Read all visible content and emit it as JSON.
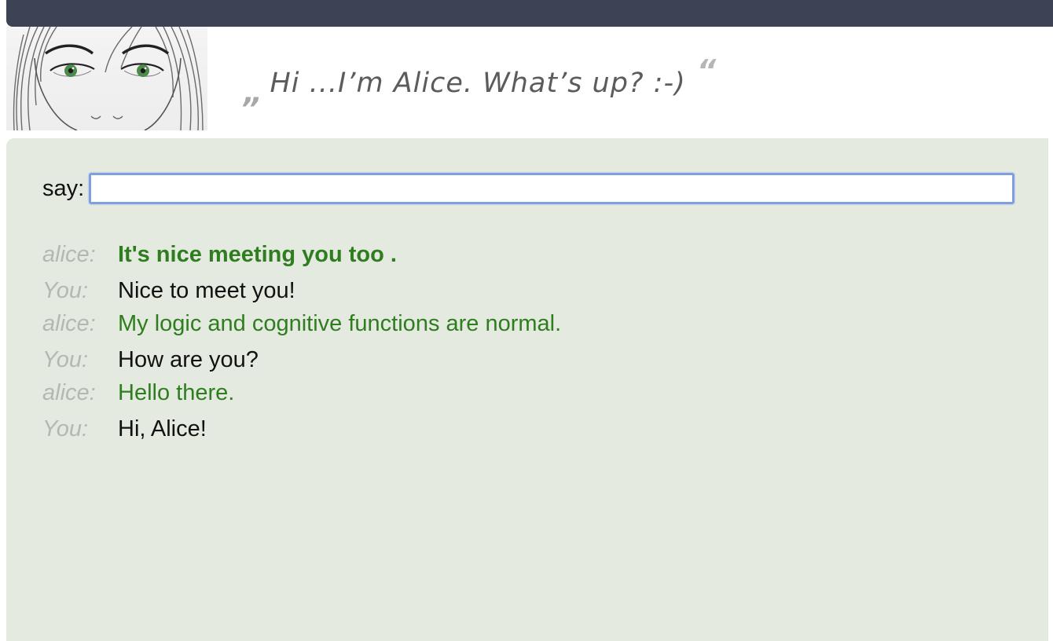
{
  "header": {
    "quote_open": "„",
    "greeting": "Hi ...I’m Alice. What’s up? :-)",
    "quote_close": "“"
  },
  "input": {
    "label": "say:",
    "value": "",
    "placeholder": ""
  },
  "messages": [
    {
      "speaker": "alice:",
      "text": "It's nice meeting you too ."
    },
    {
      "speaker": "You:",
      "text": "Nice to meet you!"
    },
    {
      "speaker": "alice:",
      "text": "My logic and cognitive functions are normal."
    },
    {
      "speaker": "You:",
      "text": "How are you?"
    },
    {
      "speaker": "alice:",
      "text": "Hello there."
    },
    {
      "speaker": "You:",
      "text": "Hi, Alice!"
    }
  ],
  "colors": {
    "topbar": "#3d4354",
    "panel": "#e4eadf",
    "alice_text": "#2e7d1e",
    "user_text": "#111111",
    "speaker_label": "#b4b8b3",
    "input_border": "#7f9fe0"
  },
  "icons": {
    "avatar": "alice-face-avatar"
  }
}
